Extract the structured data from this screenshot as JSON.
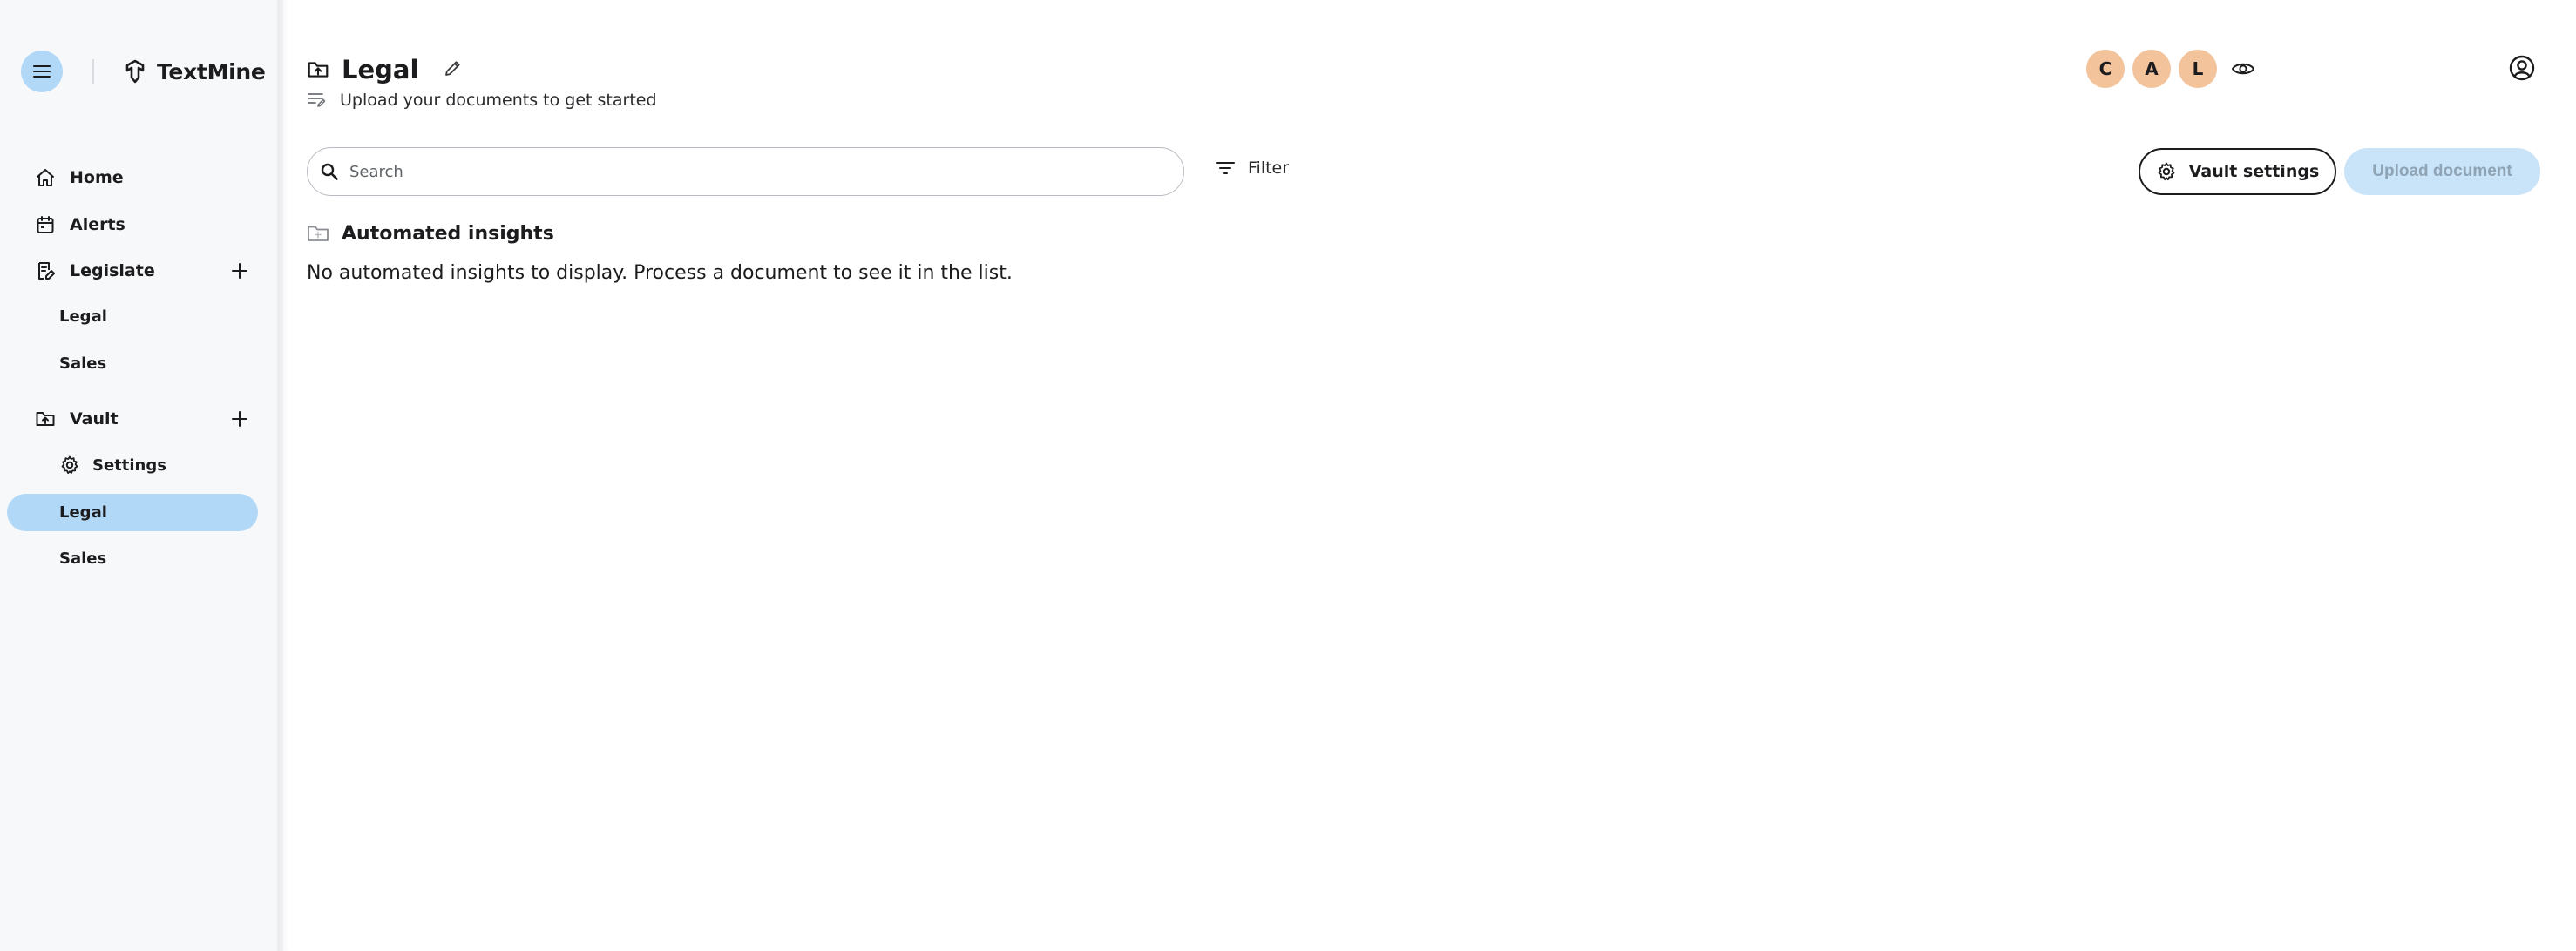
{
  "brand": {
    "name": "TextMine"
  },
  "sidebar": {
    "home_label": "Home",
    "alerts_label": "Alerts",
    "legislate": {
      "label": "Legislate",
      "items": [
        {
          "label": "Legal"
        },
        {
          "label": "Sales"
        }
      ]
    },
    "vault": {
      "label": "Vault",
      "settings_label": "Settings",
      "items": [
        {
          "label": "Legal",
          "active": true
        },
        {
          "label": "Sales",
          "active": false
        }
      ]
    }
  },
  "header": {
    "title": "Legal",
    "subtitle": "Upload your documents to get started",
    "collaborators": [
      {
        "initial": "C"
      },
      {
        "initial": "A"
      },
      {
        "initial": "L"
      }
    ]
  },
  "toolbar": {
    "search_placeholder": "Search",
    "search_value": "",
    "filter_label": "Filter",
    "vault_settings_label": "Vault settings",
    "upload_label": "Upload document"
  },
  "insights": {
    "title": "Automated insights",
    "empty_message": "No automated insights to display. Process a document to see it in the list."
  },
  "colors": {
    "accent": "#b2d8f7",
    "avatar": "#f3c39b",
    "upload_disabled_bg": "#c9e3f8",
    "upload_disabled_text": "#8ea3b4"
  },
  "icons": {
    "menu": "hamburger-icon",
    "brand": "textmine-logo-icon",
    "home": "home-icon",
    "alerts": "calendar-icon",
    "legislate": "document-edit-icon",
    "vault": "folder-upload-icon",
    "settings": "gear-icon",
    "add": "plus-icon",
    "edit": "pencil-icon",
    "subtitle": "text-lines-icon",
    "visibility": "eye-icon",
    "account": "account-circle-icon",
    "search": "search-icon",
    "filter": "filter-icon",
    "insights": "folder-icon"
  }
}
